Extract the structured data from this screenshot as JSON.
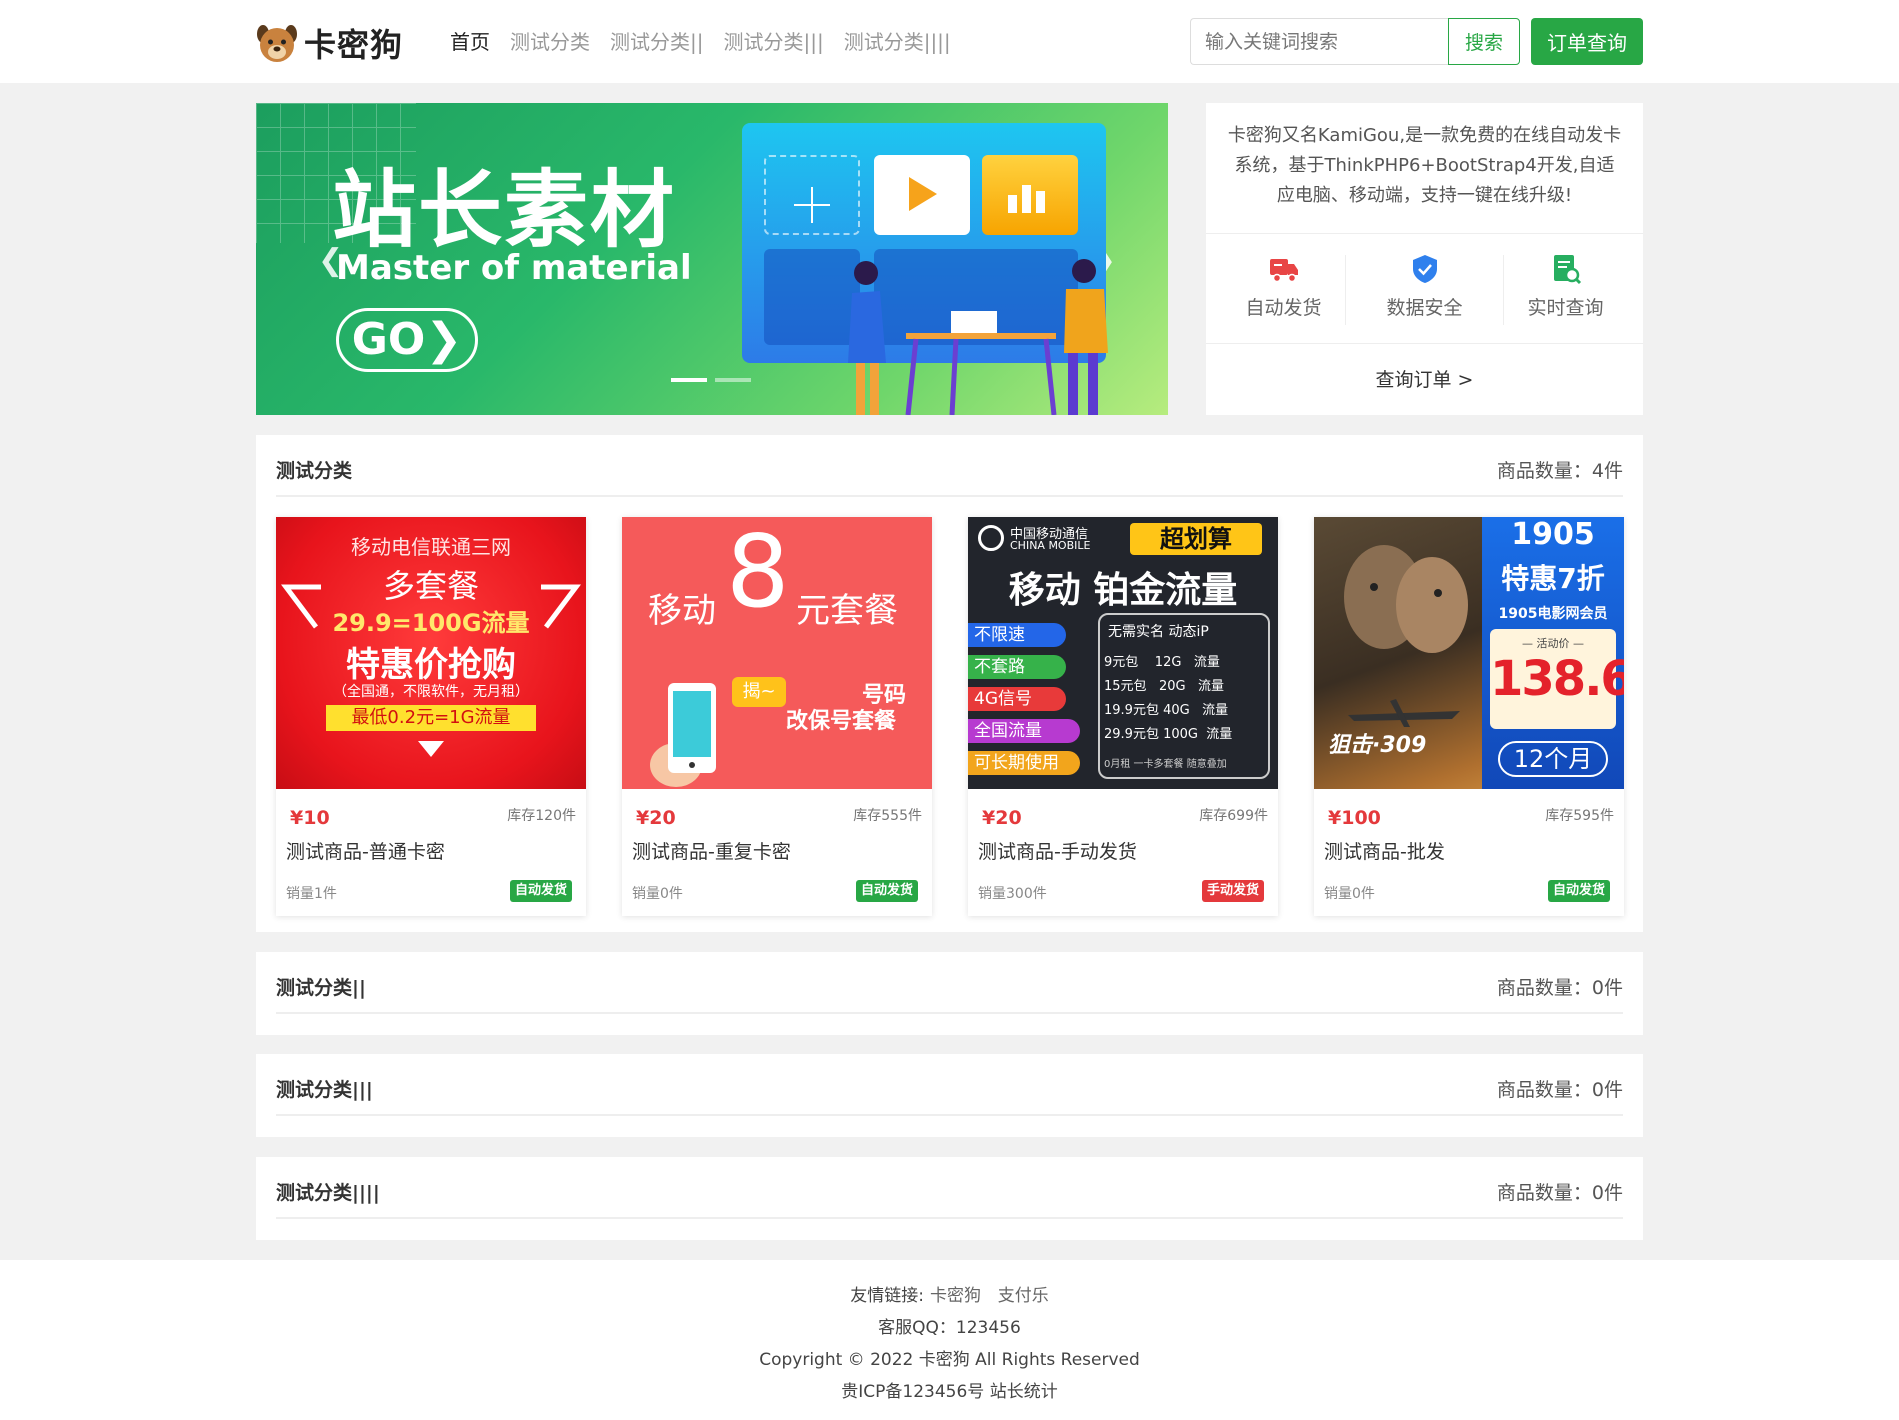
{
  "header": {
    "logo_text": "卡密狗",
    "nav": [
      "首页",
      "测试分类",
      "测试分类||",
      "测试分类|||",
      "测试分类||||"
    ],
    "search_placeholder": "输入关键词搜索",
    "search_button": "搜索",
    "order_button": "订单查询"
  },
  "banner": {
    "title": "站长素材",
    "subtitle": "Master of material",
    "go": "GO❯",
    "slide_count": 2,
    "active_slide": 1
  },
  "info": {
    "description": "卡密狗又名KamiGou,是一款免费的在线自动发卡系统，基于ThinkPHP6+BootStrap4开发,自适应电脑、移动端，支持一键在线升级!",
    "features": [
      {
        "label": "自动发货",
        "icon": "truck-icon",
        "color": "#e84545"
      },
      {
        "label": "数据安全",
        "icon": "shield-icon",
        "color": "#2f80ed"
      },
      {
        "label": "实时查询",
        "icon": "document-search-icon",
        "color": "#27ae60"
      }
    ],
    "link": "查询订单 >"
  },
  "sections": [
    {
      "title": "测试分类",
      "count_label": "商品数量：4件",
      "products": [
        {
          "price": "¥10",
          "stock": "库存120件",
          "name": "测试商品-普通卡密",
          "sales": "销量1件",
          "badge": "自动发货",
          "badge_type": "auto",
          "img_lines": [
            "移动电信联通三网",
            "多套餐",
            "29.9=100G流量",
            "特惠价抢购",
            "（全国通，不限软件，无月租）",
            "最低0.2元=1G流量"
          ]
        },
        {
          "price": "¥20",
          "stock": "库存555件",
          "name": "测试商品-重复卡密",
          "sales": "销量0件",
          "badge": "自动发货",
          "badge_type": "auto",
          "img_lines": [
            "移动",
            "8",
            "元套餐",
            "揭~",
            "号码",
            "改保号套餐"
          ]
        },
        {
          "price": "¥20",
          "stock": "库存699件",
          "name": "测试商品-手动发货",
          "sales": "销量300件",
          "badge": "手动发货",
          "badge_type": "manual",
          "img_lines": [
            "中国移动通信",
            "CHINA MOBILE",
            "超划算",
            "移动 铂金流量",
            "不限速",
            "不套路",
            "4G信号",
            "全国流量",
            "可长期使用",
            "无需实名  动态iP",
            "9元包    12G   流量",
            "15元包   20G   流量",
            "19.9元包 40G   流量",
            "29.9元包 100G  流量",
            "0月租 一卡多套餐 随意叠加"
          ]
        },
        {
          "price": "¥100",
          "stock": "库存595件",
          "name": "测试商品-批发",
          "sales": "销量0件",
          "badge": "自动发货",
          "badge_type": "auto",
          "img_lines": [
            "1905",
            "特惠7折",
            "1905电影网会员",
            "— 活动价 —",
            "138.6",
            "12个月",
            "狙击·309"
          ]
        }
      ]
    },
    {
      "title": "测试分类||",
      "count_label": "商品数量：0件"
    },
    {
      "title": "测试分类|||",
      "count_label": "商品数量：0件"
    },
    {
      "title": "测试分类||||",
      "count_label": "商品数量：0件"
    }
  ],
  "footer": {
    "links_label": "友情链接:",
    "links": [
      "卡密狗",
      "支付乐"
    ],
    "qq": "客服QQ：123456",
    "copyright": "Copyright © 2022 卡密狗 All Rights Reserved",
    "icp": "贵ICP备123456号 站长统计"
  },
  "colors": {
    "accent": "#28a745",
    "price": "#e4393c",
    "manual_badge": "#e4393c"
  }
}
